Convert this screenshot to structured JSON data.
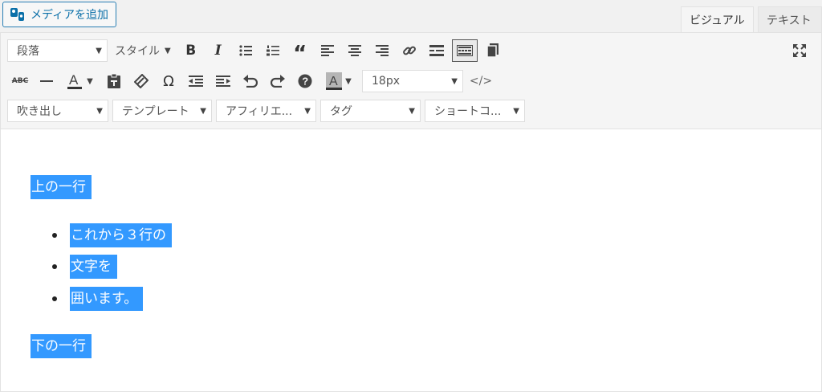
{
  "topbar": {
    "media_button_label": "メディアを追加",
    "tabs": [
      {
        "label": "ビジュアル"
      },
      {
        "label": "テキスト"
      }
    ]
  },
  "toolbar": {
    "format_select": "段落",
    "style_dropdown": "スタイル",
    "font_size_select": "18px",
    "strikethrough_label": "ABC",
    "dropdowns": [
      {
        "label": "吹き出し"
      },
      {
        "label": "テンプレート"
      },
      {
        "label": "アフィリエ..."
      },
      {
        "label": "タグ"
      },
      {
        "label": "ショートコ..."
      }
    ],
    "icons": {
      "row1": [
        "bold-icon",
        "italic-icon",
        "bulleted-list-icon",
        "numbered-list-icon",
        "blockquote-icon",
        "align-left-icon",
        "align-center-icon",
        "align-right-icon",
        "link-icon",
        "read-more-icon",
        "toolbar-toggle-icon",
        "copy-icon",
        "fullscreen-icon"
      ],
      "row2": [
        "strikethrough-icon",
        "horizontal-line-icon",
        "text-color-icon",
        "paste-as-text-icon",
        "clear-formatting-icon",
        "special-character-icon",
        "outdent-icon",
        "indent-icon",
        "undo-icon",
        "redo-icon",
        "help-icon",
        "background-color-icon",
        "code-icon"
      ]
    }
  },
  "content": {
    "para_top": "上の一行",
    "list_items": [
      "これから３行の",
      "文字を",
      "囲います。"
    ],
    "para_bottom": "下の一行"
  },
  "colors": {
    "selection": "#3399ff",
    "media_button_border": "#2a7fb4"
  }
}
